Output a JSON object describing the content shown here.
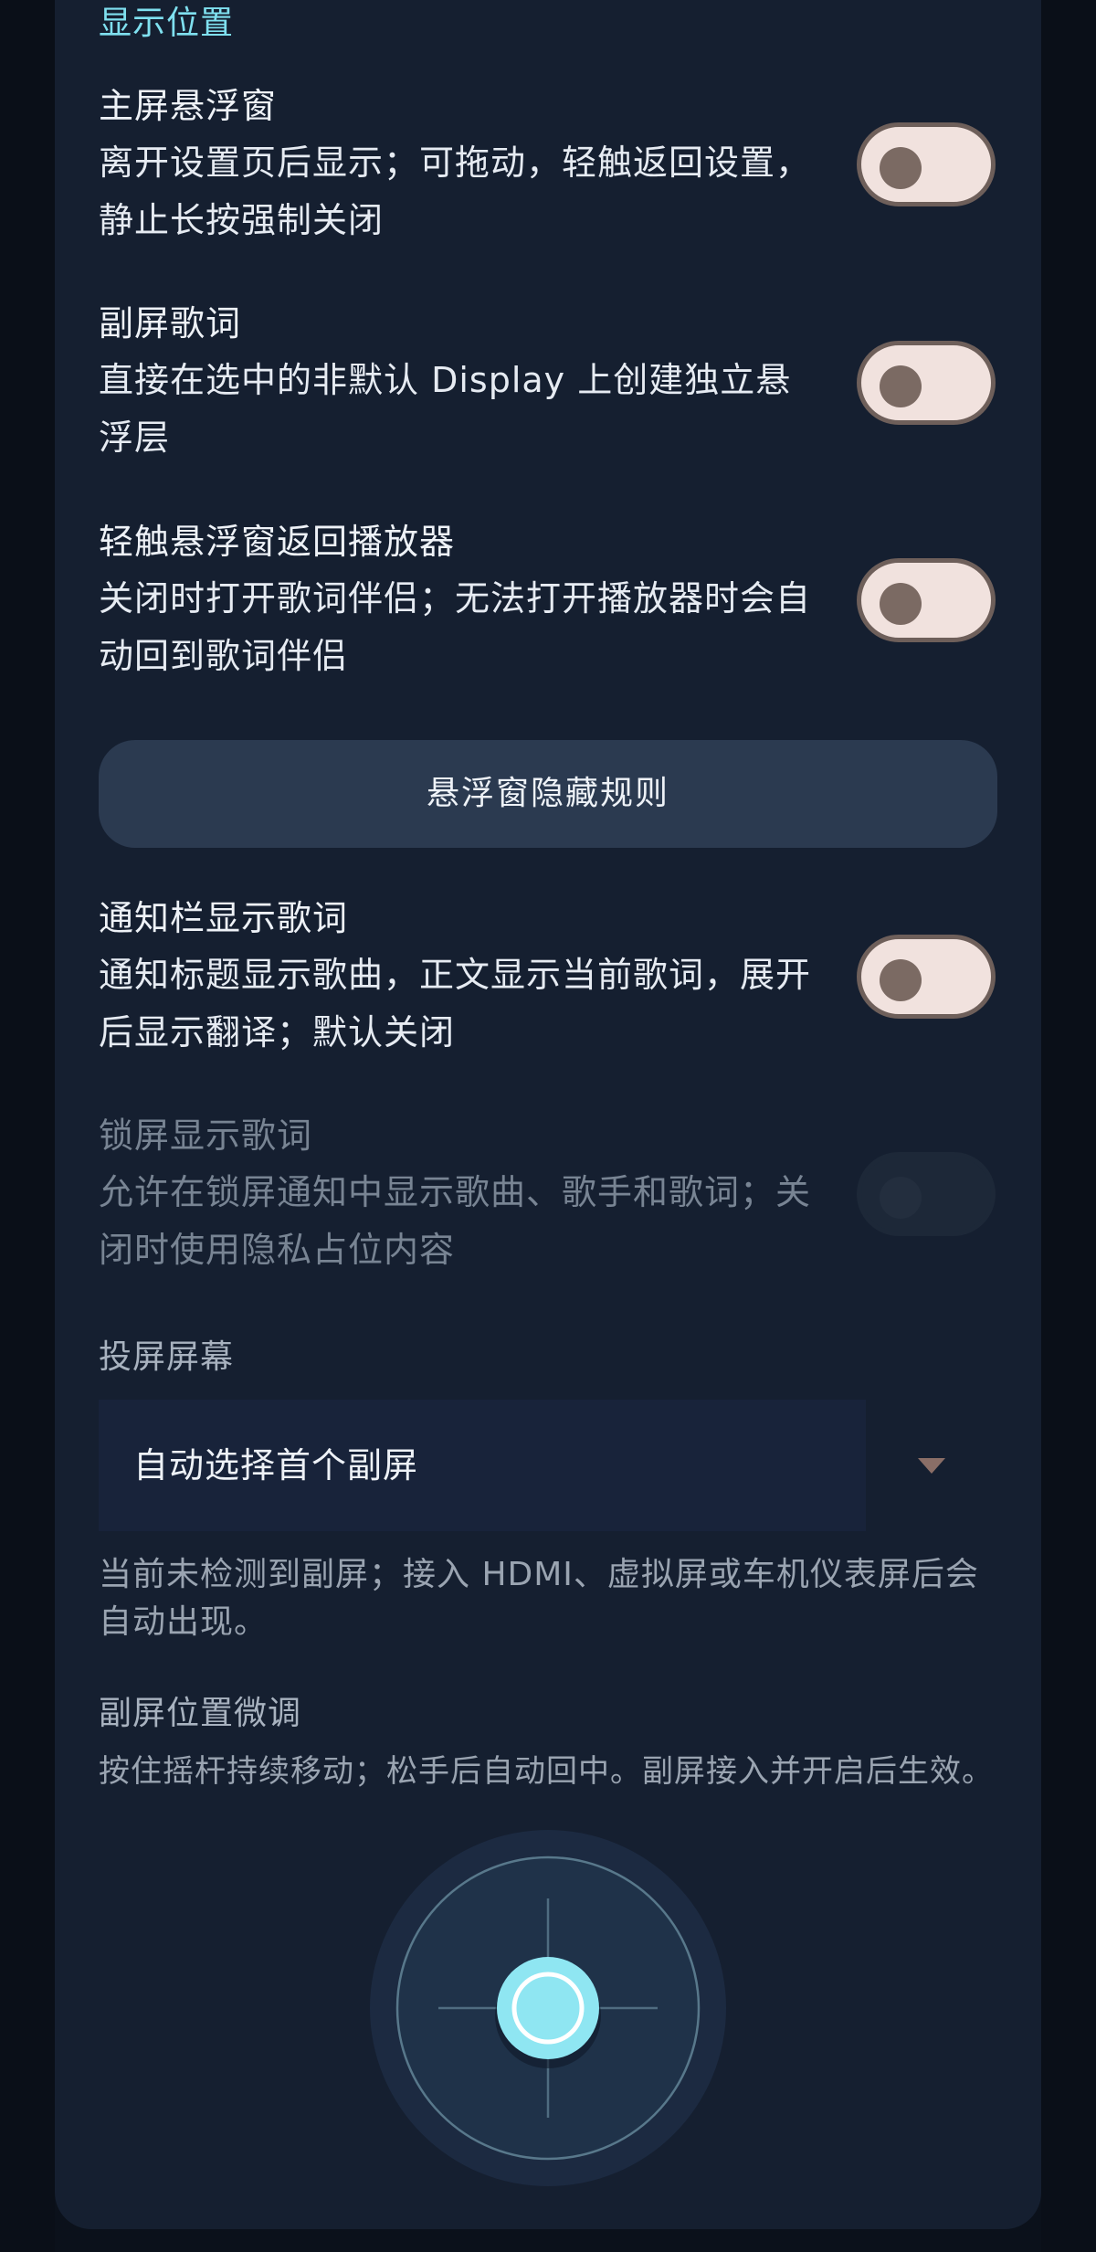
{
  "section_header": "显示位置",
  "settings": [
    {
      "title": "主屏悬浮窗",
      "description": "离开设置页后显示；可拖动，轻触返回设置，静止长按强制关闭",
      "enabled": false,
      "disabled": false
    },
    {
      "title": "副屏歌词",
      "description": "直接在选中的非默认 Display 上创建独立悬浮层",
      "enabled": false,
      "disabled": false
    },
    {
      "title": "轻触悬浮窗返回播放器",
      "description": "关闭时打开歌词伴侣；无法打开播放器时会自动回到歌词伴侣",
      "enabled": false,
      "disabled": false
    },
    {
      "title": "通知栏显示歌词",
      "description": "通知标题显示歌曲，正文显示当前歌词，展开后显示翻译；默认关闭",
      "enabled": false,
      "disabled": false
    },
    {
      "title": "锁屏显示歌词",
      "description": "允许在锁屏通知中显示歌曲、歌手和歌词；关闭时使用隐私占位内容",
      "enabled": false,
      "disabled": true
    }
  ],
  "hide_rules_button": "悬浮窗隐藏规则",
  "cast_screen": {
    "label": "投屏屏幕",
    "selected": "自动选择首个副屏",
    "helper": "当前未检测到副屏；接入 HDMI、虚拟屏或车机仪表屏后会自动出现。"
  },
  "fine_tune": {
    "label": "副屏位置微调",
    "helper": "按住摇杆持续移动；松手后自动回中。副屏接入并开启后生效。"
  },
  "colors": {
    "accent": "#7fe0ef",
    "card_background": "#151f30",
    "page_background": "#0b111b",
    "toggle_track": "#f1e2de",
    "toggle_knob": "#7b6a63",
    "joystick_knob": "#8fe6f2"
  },
  "icons": {
    "dropdown": "chevron-down-icon",
    "joystick": "joystick-icon"
  }
}
